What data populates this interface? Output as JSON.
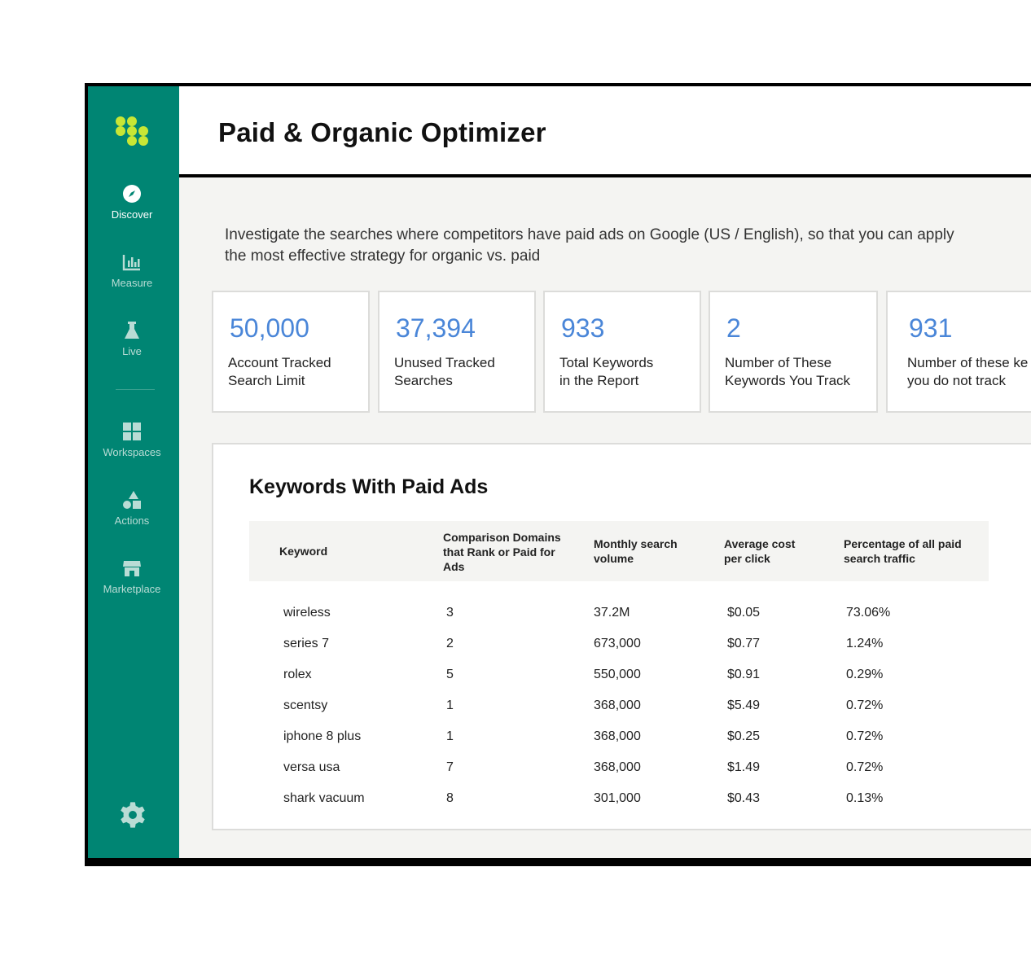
{
  "sidebar": {
    "items": [
      {
        "label": "Discover",
        "icon": "compass-icon",
        "active": true
      },
      {
        "label": "Measure",
        "icon": "bar-chart-icon",
        "active": false
      },
      {
        "label": "Live",
        "icon": "flask-icon",
        "active": false
      },
      {
        "label": "Workspaces",
        "icon": "grid-icon",
        "active": false
      },
      {
        "label": "Actions",
        "icon": "shapes-icon",
        "active": false
      },
      {
        "label": "Marketplace",
        "icon": "store-icon",
        "active": false
      }
    ],
    "colors": {
      "background": "#008573",
      "logo": "#c8e635"
    }
  },
  "header": {
    "title": "Paid & Organic Optimizer"
  },
  "intro": "Investigate the searches where competitors have paid ads on Google (US / English), so that you can apply the most effective strategy for organic vs. paid",
  "stats": [
    {
      "value": "50,000",
      "caption": "Account Tracked\nSearch Limit"
    },
    {
      "value": "37,394",
      "caption": "Unused Tracked\nSearches"
    },
    {
      "value": "933",
      "caption": "Total Keywords\nin the Report"
    },
    {
      "value": "2",
      "caption": "Number of These\nKeywords You Track"
    },
    {
      "value": "931",
      "caption": "Number of these ke\nyou do not track"
    }
  ],
  "table": {
    "title": "Keywords With Paid Ads",
    "columns": [
      "Keyword",
      "Comparison Domains that Rank or Paid for Ads",
      "Monthly search volume",
      "Average cost per click",
      "Percentage of all paid search traffic"
    ],
    "rows": [
      [
        "wireless",
        "3",
        "37.2M",
        "$0.05",
        "73.06%"
      ],
      [
        "series 7",
        "2",
        "673,000",
        "$0.77",
        "1.24%"
      ],
      [
        "rolex",
        "5",
        "550,000",
        "$0.91",
        "0.29%"
      ],
      [
        "scentsy",
        "1",
        "368,000",
        "$5.49",
        "0.72%"
      ],
      [
        "iphone 8 plus",
        "1",
        "368,000",
        "$0.25",
        "0.72%"
      ],
      [
        "versa usa",
        "7",
        "368,000",
        "$1.49",
        "0.72%"
      ],
      [
        "shark vacuum",
        "8",
        "301,000",
        "$0.43",
        "0.13%"
      ]
    ]
  },
  "colors": {
    "accent_number": "#4a86d8",
    "page_bg": "#f4f4f2"
  }
}
